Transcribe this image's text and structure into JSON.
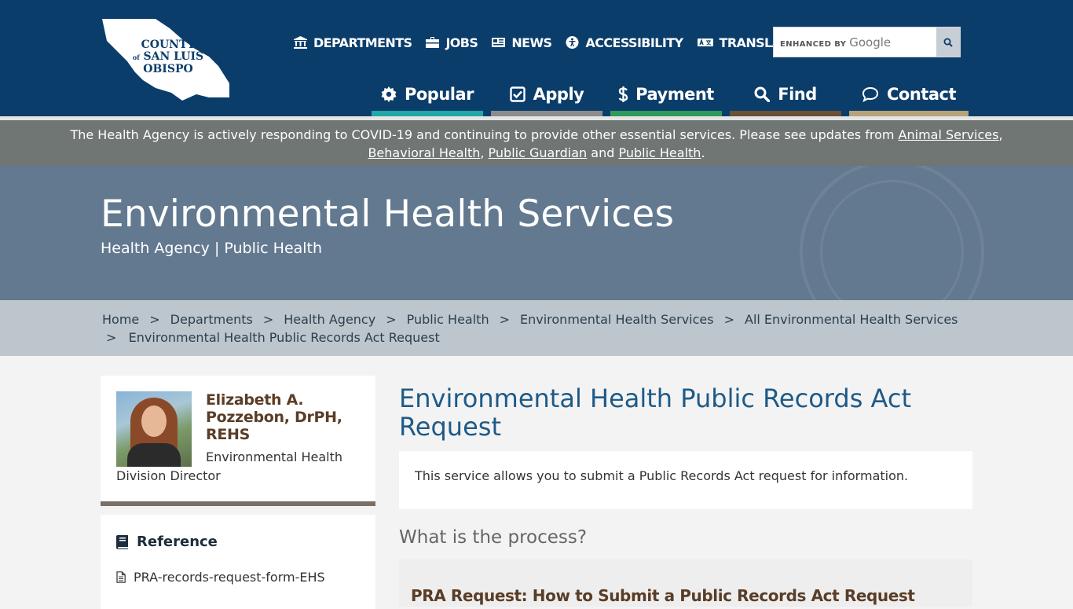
{
  "header": {
    "logo_lines": [
      "COUNTY",
      "SAN LUIS",
      "OBISPO"
    ],
    "logo_of": "of",
    "topnav": [
      {
        "label": "DEPARTMENTS",
        "icon": "building-icon"
      },
      {
        "label": "JOBS",
        "icon": "briefcase-icon"
      },
      {
        "label": "NEWS",
        "icon": "newspaper-icon"
      },
      {
        "label": "ACCESSIBILITY",
        "icon": "accessibility-icon"
      },
      {
        "label": "TRANSLATE",
        "icon": "translate-icon"
      }
    ],
    "search": {
      "enhanced_by": "ENHANCED BY",
      "google": "Google",
      "icon": "search-icon"
    },
    "mainnav": [
      {
        "label": "Popular",
        "icon": "gear-icon",
        "bar_color": "#1fa8a5"
      },
      {
        "label": "Apply",
        "icon": "checkbox-icon",
        "bar_color": "#8c8c8c"
      },
      {
        "label": "Payment",
        "icon": "dollar-icon",
        "bar_color": "#2f9a5c"
      },
      {
        "label": "Find",
        "icon": "search-icon",
        "bar_color": "#6b4f36"
      },
      {
        "label": "Contact",
        "icon": "chat-icon",
        "bar_color": "#b8a27a"
      }
    ]
  },
  "alert": {
    "text_before": "The Health Agency is actively responding to COVID-19 and continuing to provide other essential services. Please see updates from ",
    "link1": "Animal Services",
    "comma1": ",",
    "link2": "Behavioral Health",
    "comma2": ", ",
    "link3": "Public Guardian",
    "and": " and ",
    "link4": "Public Health",
    "period": "."
  },
  "hero": {
    "title": "Environmental Health Services",
    "subtitle": "Health Agency | Public Health"
  },
  "breadcrumb": {
    "items": [
      "Home",
      "Departments",
      "Health Agency",
      "Public Health",
      "Environmental Health Services",
      "All Environmental Health Services"
    ],
    "current": "Environmental Health Public Records Act Request",
    "separator": ">"
  },
  "sidebar": {
    "person": {
      "name": "Elizabeth A. Pozzebon, DrPH, REHS",
      "role_line1": "Environmental Health",
      "role_line2": "Division Director"
    },
    "reference": {
      "title": "Reference",
      "links": [
        "PRA-records-request-form-EHS"
      ]
    }
  },
  "main": {
    "title": "Environmental Health Public Records Act Request",
    "intro": "This service allows you to submit a Public Records Act request for information.",
    "process_heading": "What is the process?",
    "step_title": "PRA Request: How to Submit a Public Records Act Request"
  },
  "colors": {
    "header_bg": "#0b3d6b",
    "alert_bg": "#6f7673",
    "hero_bg": "#627990",
    "breadcrumb_bg": "#bcc6cc",
    "title_blue": "#1e5a87",
    "brown": "#5a3d27"
  }
}
